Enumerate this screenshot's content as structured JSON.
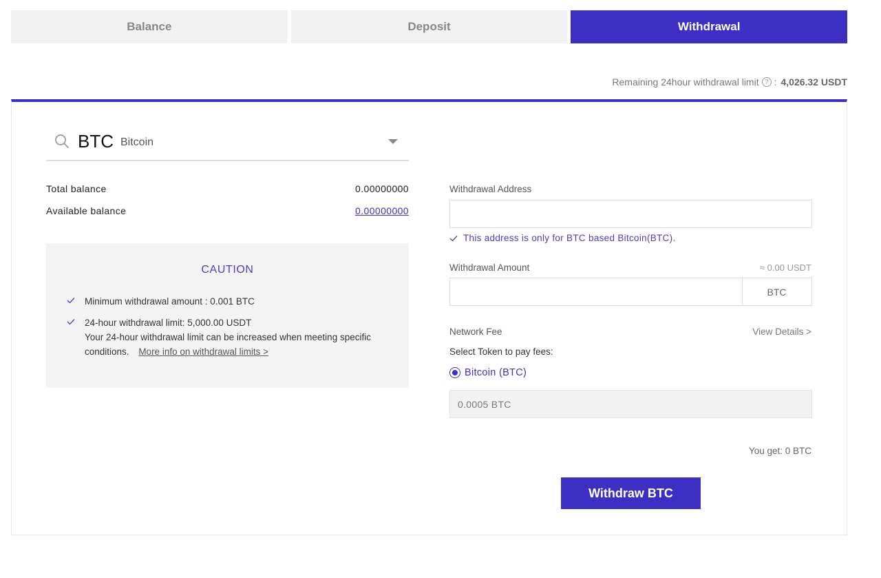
{
  "tabs": [
    {
      "label": "Balance",
      "active": false
    },
    {
      "label": "Deposit",
      "active": false
    },
    {
      "label": "Withdrawal",
      "active": true
    }
  ],
  "limit": {
    "label": "Remaining 24hour withdrawal limit",
    "separator": ":",
    "value": "4,026.32 USDT"
  },
  "coin": {
    "symbol": "BTC",
    "name": "Bitcoin"
  },
  "balances": {
    "total_label": "Total balance",
    "total_value": "0.00000000",
    "available_label": "Available balance",
    "available_value": "0.00000000"
  },
  "caution": {
    "title": "CAUTION",
    "item1": "Minimum withdrawal amount : 0.001 BTC",
    "item2_line1": "24-hour withdrawal limit: 5,000.00 USDT",
    "item2_line2": "Your 24-hour withdrawal limit can be increased when meeting specific conditions.",
    "item2_link": "More info on withdrawal limits >"
  },
  "form": {
    "address_label": "Withdrawal Address",
    "address_value": "",
    "address_note": "This address is only for BTC based Bitcoin(BTC).",
    "amount_label": "Withdrawal Amount",
    "amount_value": "",
    "approx_value": "≈ 0.00 USDT",
    "amount_unit": "BTC",
    "network_fee_label": "Network Fee",
    "view_details": "View Details >",
    "select_token_label": "Select Token to pay fees:",
    "token_option": "Bitcoin (BTC)",
    "fee_value": "0.0005 BTC",
    "you_get": "You get: 0 BTC",
    "submit_label": "Withdraw BTC"
  },
  "colors": {
    "accent": "#3d2fc4"
  }
}
